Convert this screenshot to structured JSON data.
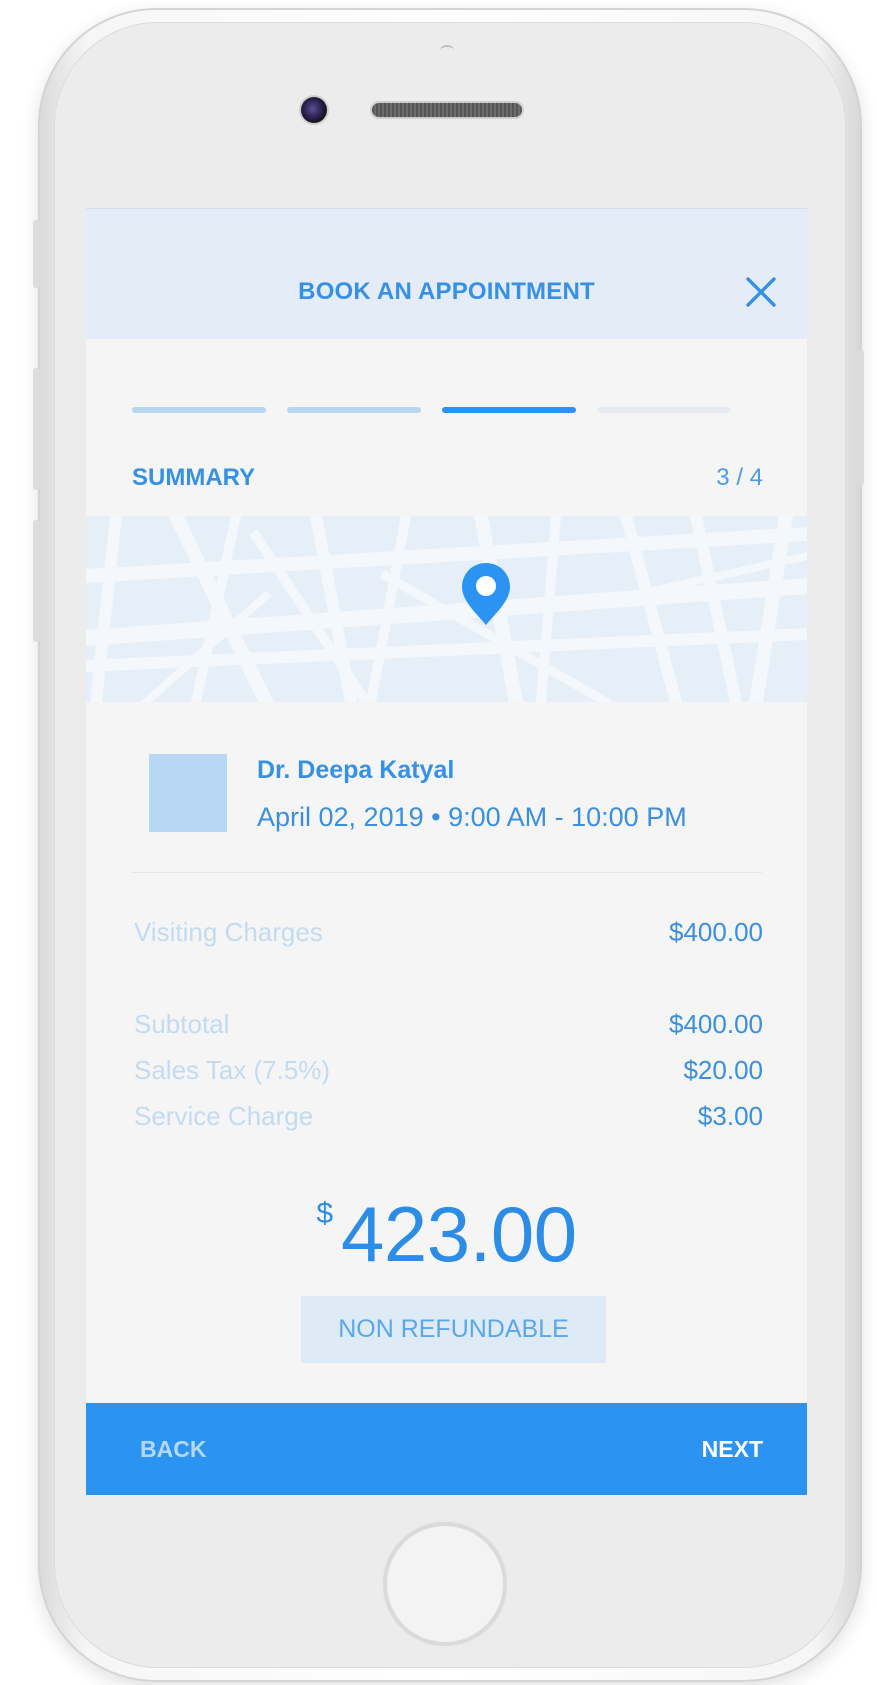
{
  "header": {
    "title": "BOOK AN APPOINTMENT",
    "close_icon": "close-icon"
  },
  "progress": {
    "current_step": 3,
    "total_steps": 4,
    "step_colors": [
      "#b6d6f2",
      "#b6d6f2",
      "#2b94f3",
      "#e6ebf1"
    ]
  },
  "section": {
    "title": "SUMMARY",
    "step_counter": "3 / 4"
  },
  "map": {
    "pin_icon": "map-pin-icon"
  },
  "appointment": {
    "doctor_name": "Dr. Deepa Katyal",
    "datetime": "April 02, 2019 • 9:00 AM - 10:00 PM"
  },
  "charges": {
    "visiting": {
      "label": "Visiting Charges",
      "value": "$400.00"
    },
    "subtotal": {
      "label": "Subtotal",
      "value": "$400.00"
    },
    "sales_tax": {
      "label": "Sales Tax (7.5%)",
      "value": "$20.00"
    },
    "service": {
      "label": "Service Charge",
      "value": "$3.00"
    }
  },
  "total": {
    "currency": "$",
    "amount": "423.00",
    "note": "NON REFUNDABLE"
  },
  "footer": {
    "back_label": "BACK",
    "next_label": "NEXT"
  },
  "colors": {
    "accent": "#2b94f3",
    "header_bg": "#e4edf7",
    "avatar_placeholder": "#b7d7f5"
  }
}
